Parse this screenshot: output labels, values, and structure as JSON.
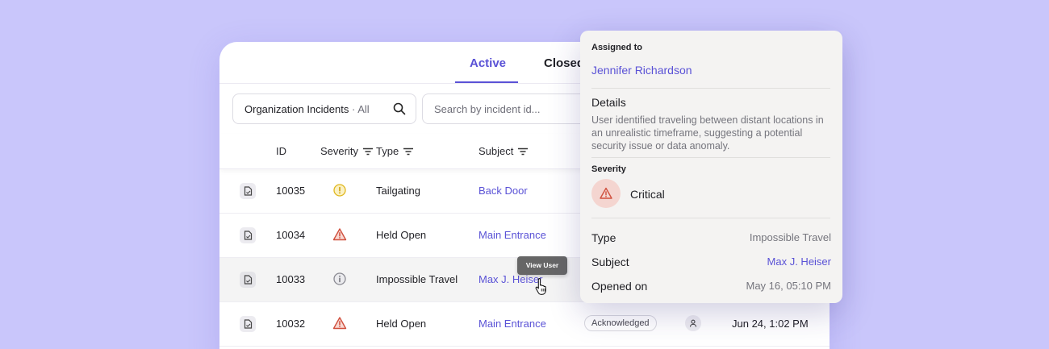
{
  "tabs": [
    {
      "label": "Active",
      "active": true
    },
    {
      "label": "Closed",
      "active": false
    }
  ],
  "filter": {
    "label": "Organization Incidents",
    "scope": " · All",
    "icon": "search-icon"
  },
  "search": {
    "placeholder": "Search by incident id..."
  },
  "table": {
    "columns": [
      "ID",
      "Severity",
      "Type",
      "Subject"
    ],
    "rows": [
      {
        "id": "10035",
        "severity": "warning",
        "type": "Tailgating",
        "subject": "Back Door"
      },
      {
        "id": "10034",
        "severity": "critical",
        "type": "Held Open",
        "subject": "Main Entrance"
      },
      {
        "id": "10033",
        "severity": "info",
        "type": "Impossible Travel",
        "subject": "Max J. Heiser"
      },
      {
        "id": "10032",
        "severity": "critical",
        "type": "Held Open",
        "subject": "Main Entrance",
        "status": "Acknowledged",
        "date": "Jun 24, 1:02 PM"
      }
    ]
  },
  "tooltip": {
    "label": "View User"
  },
  "details_panel": {
    "assigned_label": "Assigned to",
    "assigned_name": "Jennifer Richardson",
    "details_heading": "Details",
    "details_text": "User identified traveling between distant locations in an unrealistic timeframe, suggesting a potential security issue or data anomaly.",
    "severity_label": "Severity",
    "severity_value": "Critical",
    "type_label": "Type",
    "type_value": "Impossible Travel",
    "subject_label": "Subject",
    "subject_value": "Max J. Heiser",
    "opened_label": "Opened on",
    "opened_value": "May 16, 05:10 PM"
  },
  "colors": {
    "background": "#c9c6fb",
    "accent": "#5a52d6",
    "warning": "#e9c52e",
    "critical": "#d0503e",
    "info": "#8a8a92"
  }
}
